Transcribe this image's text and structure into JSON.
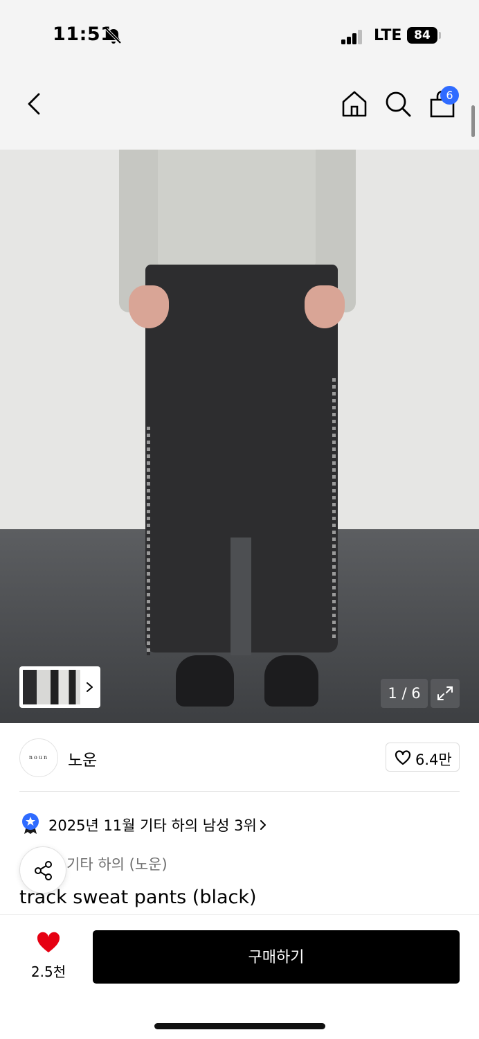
{
  "status_bar": {
    "time": "11:51",
    "network": "LTE",
    "battery": "84"
  },
  "nav": {
    "cart_count": "6"
  },
  "gallery": {
    "counter": "1 / 6"
  },
  "brand": {
    "logo_text": "noun",
    "name": "노운",
    "like_count": "6.4만"
  },
  "ranking": {
    "text": "2025년 11월 기타 하의 남성 3위"
  },
  "product": {
    "category": "기타 하의 (노운)",
    "title": "track sweat pants (black)"
  },
  "bottom_bar": {
    "wish_count": "2.5천",
    "buy_label": "구매하기"
  },
  "colors": {
    "accent": "#2f6bff",
    "heart": "#e60012",
    "buy_button": "#000000"
  },
  "icons": [
    "bell-slash-icon",
    "signal-icon",
    "battery-icon",
    "back-chevron-icon",
    "home-icon",
    "search-icon",
    "shopping-bag-icon",
    "chevron-right-icon",
    "expand-icon",
    "heart-outline-icon",
    "rank-badge-icon",
    "share-icon",
    "heart-filled-icon"
  ]
}
